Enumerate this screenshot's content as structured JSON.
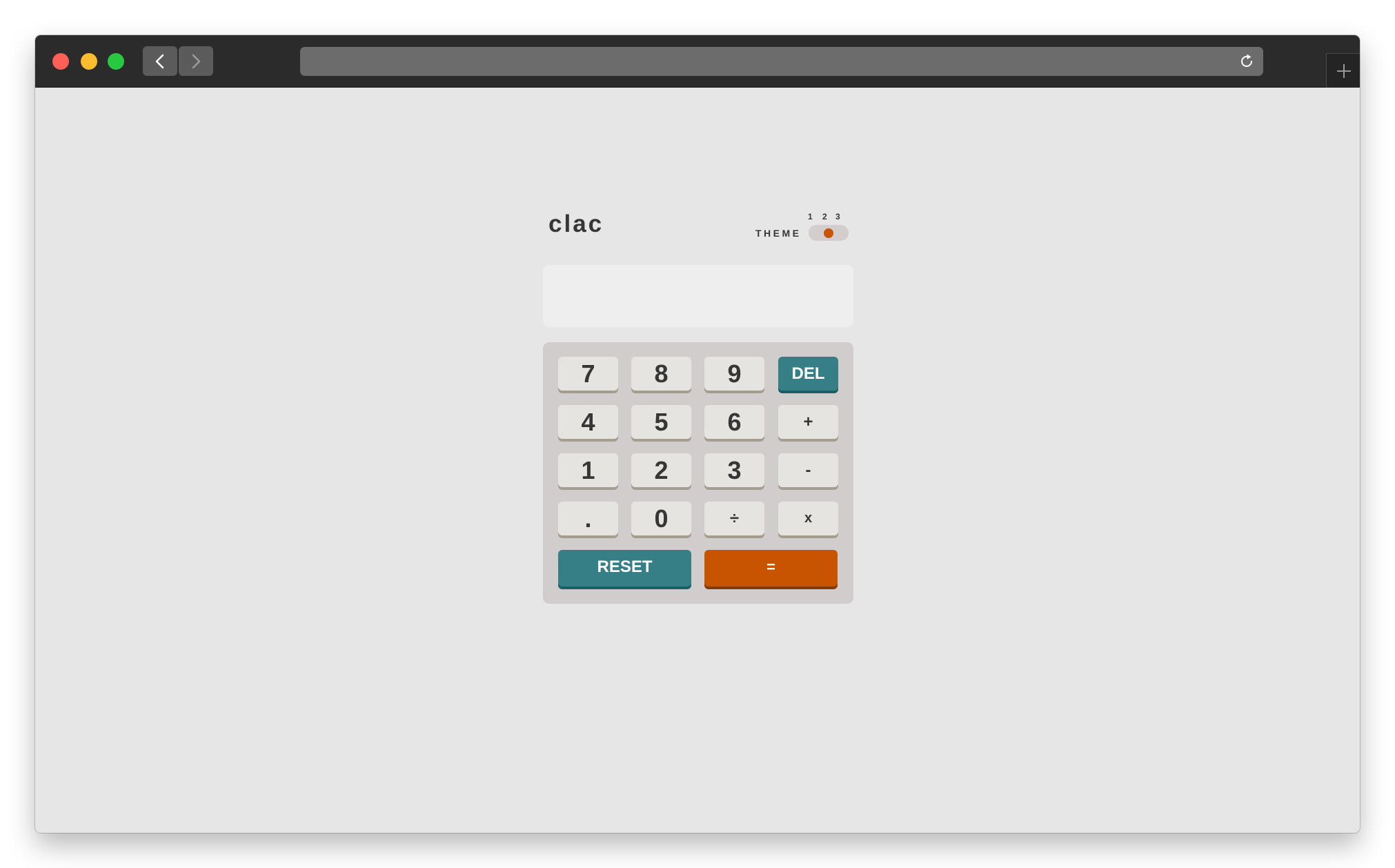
{
  "browser": {
    "traffic_lights": {
      "close_color": "#fe5f57",
      "minimize_color": "#febc2e",
      "maximize_color": "#28c840"
    },
    "nav": {
      "back_icon": "chevron-left-icon",
      "forward_icon": "chevron-right-icon"
    },
    "address_bar": {
      "url": "",
      "reload_icon": "reload-icon"
    },
    "new_tab_icon": "plus-icon"
  },
  "app": {
    "brand": "clac",
    "theme": {
      "label": "THEME",
      "options": [
        "1",
        "2",
        "3"
      ],
      "selected": "2"
    },
    "display": {
      "value": ""
    },
    "keys": {
      "k7": "7",
      "k8": "8",
      "k9": "9",
      "del": "DEL",
      "k4": "4",
      "k5": "5",
      "k6": "6",
      "plus": "+",
      "k1": "1",
      "k2": "2",
      "k3": "3",
      "minus": "-",
      "dot": ".",
      "k0": "0",
      "divide": "÷",
      "times": "x",
      "reset": "RESET",
      "equals": "="
    },
    "colors": {
      "background": "#e6e6e6",
      "key": "#e5e4e1",
      "accent_teal": "#377f86",
      "accent_orange": "#c85402",
      "text": "#363636"
    }
  }
}
